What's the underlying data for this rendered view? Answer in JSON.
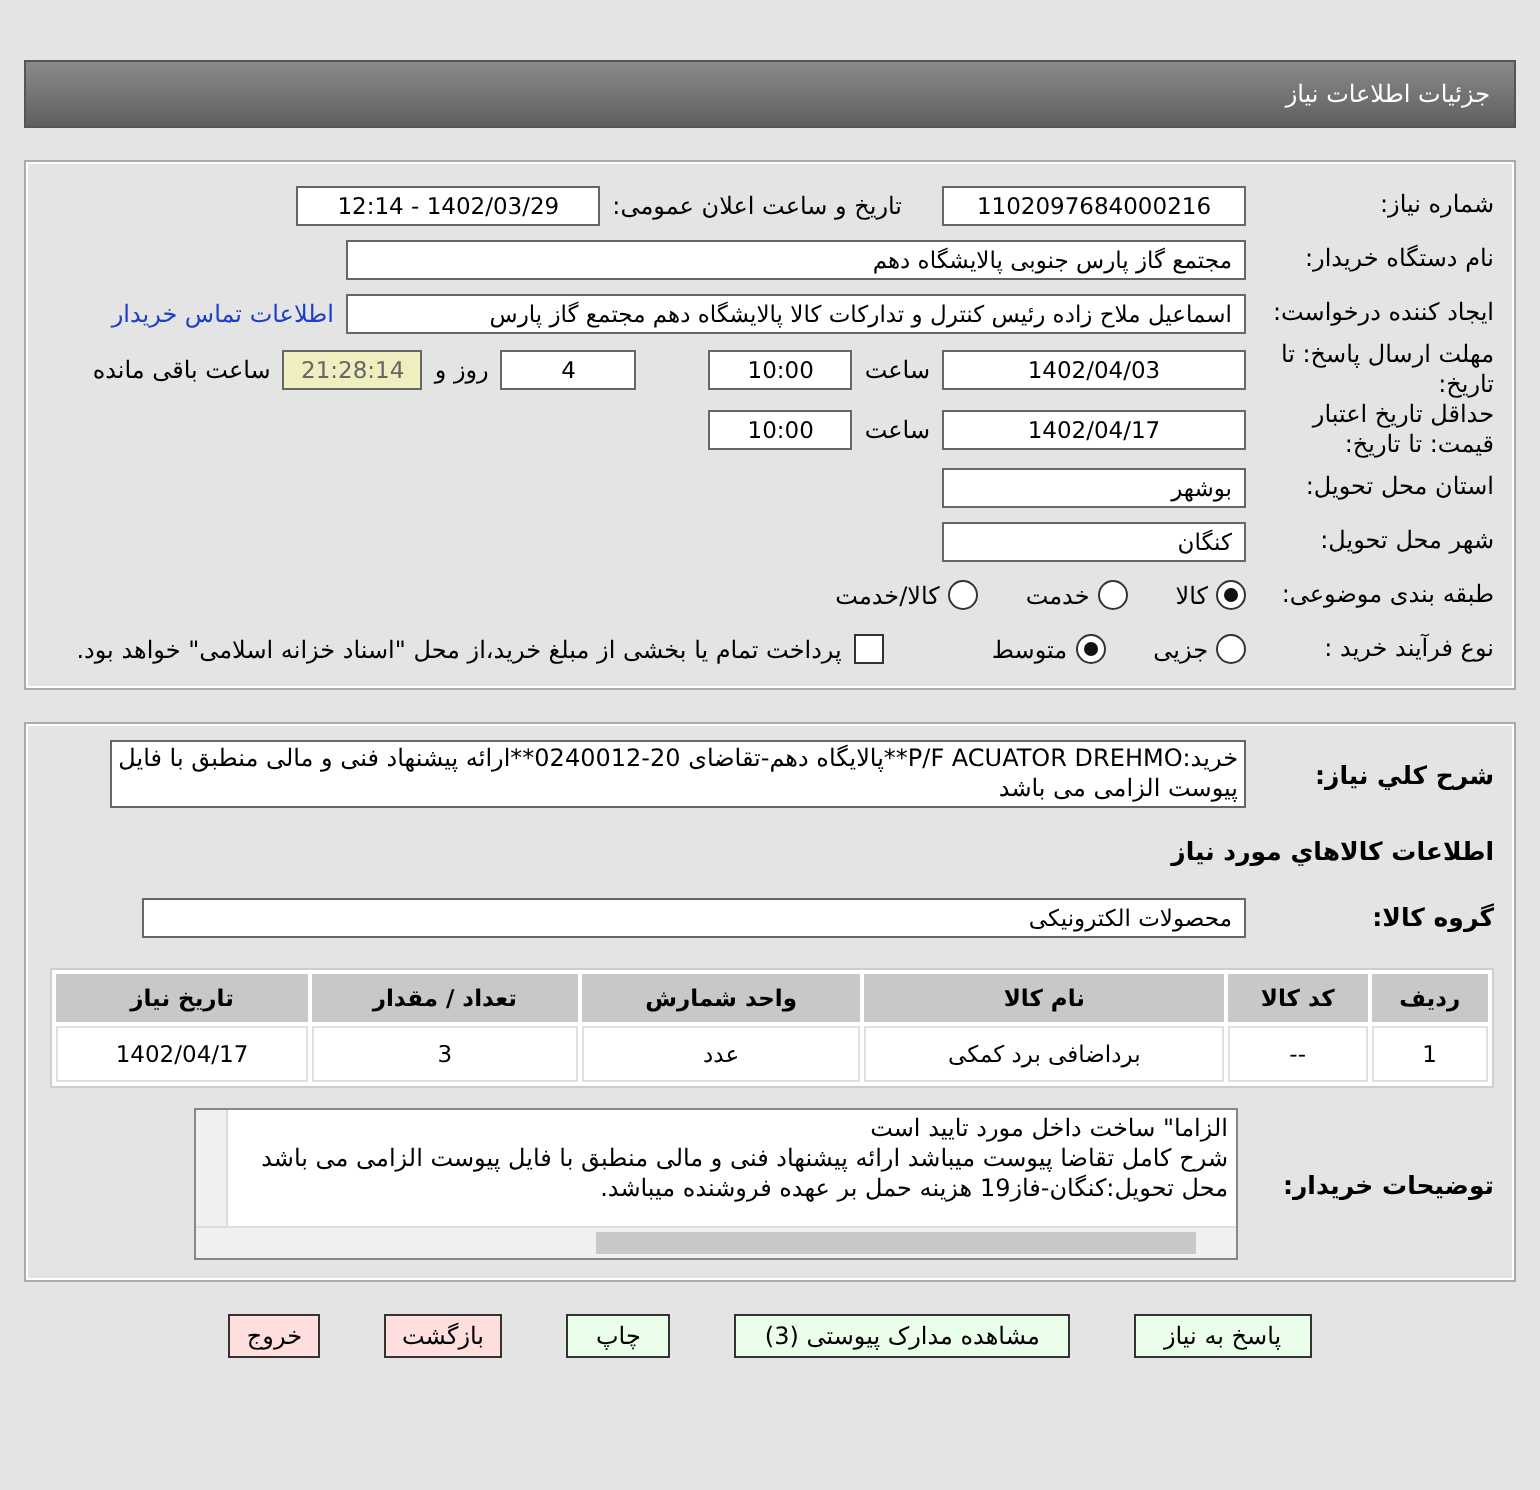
{
  "header": {
    "title": "جزئیات اطلاعات نیاز"
  },
  "need_number": {
    "label": "شماره نیاز:",
    "value": "1102097684000216"
  },
  "announce": {
    "label": "تاریخ و ساعت اعلان عمومی:",
    "value": "1402/03/29 - 12:14"
  },
  "buyer_org": {
    "label": "نام دستگاه خریدار:",
    "value": "مجتمع گاز پارس جنوبی  پالایشگاه دهم"
  },
  "requester": {
    "label": "ایجاد کننده درخواست:",
    "value": "اسماعیل ملاح زاده رئیس کنترل و تدارکات کالا پالایشگاه دهم مجتمع گاز پارس",
    "link": "اطلاعات تماس خریدار"
  },
  "reply_deadline": {
    "label": "مهلت ارسال پاسخ: تا تاریخ:",
    "date": "1402/04/03",
    "time_label": "ساعت",
    "time": "10:00",
    "days": "4",
    "days_label": "روز و",
    "remaining": "21:28:14",
    "remaining_label": "ساعت باقی مانده"
  },
  "price_validity": {
    "label": "حداقل تاریخ اعتبار قیمت: تا تاریخ:",
    "date": "1402/04/17",
    "time_label": "ساعت",
    "time": "10:00"
  },
  "province": {
    "label": "استان محل تحویل:",
    "value": "بوشهر"
  },
  "city": {
    "label": "شهر محل تحویل:",
    "value": "کنگان"
  },
  "category": {
    "label": "طبقه بندی موضوعی:",
    "options": [
      {
        "label": "کالا",
        "selected": true
      },
      {
        "label": "خدمت",
        "selected": false
      },
      {
        "label": "کالا/خدمت",
        "selected": false
      }
    ]
  },
  "purchase_type": {
    "label": "نوع فرآیند خرید :",
    "options": [
      {
        "label": "جزیی",
        "selected": false
      },
      {
        "label": "متوسط",
        "selected": true
      }
    ],
    "payment": {
      "checked": false,
      "text": "پرداخت تمام یا بخشی از مبلغ خرید،از محل \"اسناد خزانه اسلامی\" خواهد بود."
    }
  },
  "description": {
    "label": "شرح کلي نياز:",
    "text": "خرید:P/F ACUATOR DREHMO**پالایگاه دهم-تقاضای 20-0240012**ارائه پیشنهاد فنی و مالی منطبق با فایل پیوست الزامی می باشد"
  },
  "goods_heading": "اطلاعات کالاهاي مورد نياز",
  "goods_group": {
    "label": "گروه کالا:",
    "value": "محصولات الکترونیکی"
  },
  "table": {
    "columns": [
      "ردیف",
      "کد کالا",
      "نام کالا",
      "واحد شمارش",
      "تعداد / مقدار",
      "تاریخ نیاز"
    ],
    "rows": [
      [
        "1",
        "--",
        "برداضافی برد کمکی",
        "عدد",
        "3",
        "1402/04/17"
      ]
    ]
  },
  "buyer_notes": {
    "label": "توضیحات خریدار:",
    "lines": [
      "الزاما\" ساخت داخل مورد تایید است",
      "شرح کامل تقاضا پیوست میباشد ارائه پیشنهاد فنی و مالی منطبق با فایل پیوست الزامی می باشد",
      "محل تحویل:کنگان-فاز19 هزینه حمل بر عهده فروشنده میباشد."
    ]
  },
  "buttons": [
    {
      "label": "پاسخ به نیاز",
      "kind": "normal"
    },
    {
      "label": "مشاهده مدارک پیوستی (3)",
      "kind": "normal"
    },
    {
      "label": "چاپ",
      "kind": "normal"
    },
    {
      "label": "بازگشت",
      "kind": "warn"
    },
    {
      "label": "خروج",
      "kind": "warn"
    }
  ]
}
